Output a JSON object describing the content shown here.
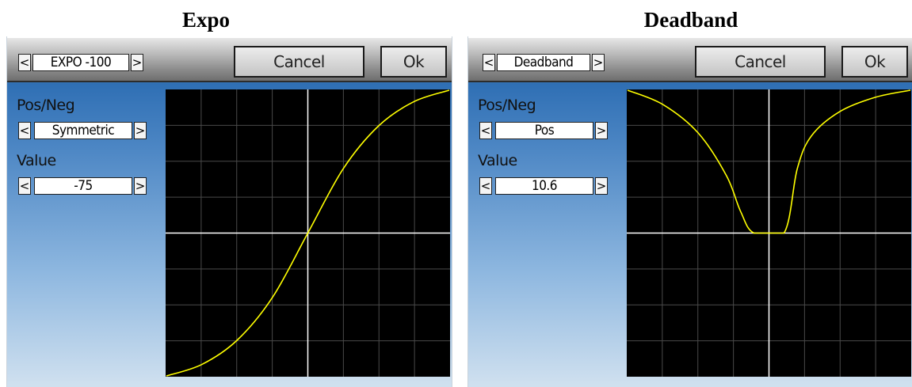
{
  "expo_panel": {
    "title": "Expo",
    "header": {
      "selector": "EXPO -100",
      "prev": "<",
      "next": ">",
      "cancel": "Cancel",
      "ok": "Ok"
    },
    "pos_neg": {
      "label": "Pos/Neg",
      "value": "Symmetric",
      "prev": "<",
      "next": ">"
    },
    "value": {
      "label": "Value",
      "value": "-75",
      "prev": "<",
      "next": ">"
    }
  },
  "deadband_panel": {
    "title": "Deadband",
    "header": {
      "selector": "Deadband",
      "prev": "<",
      "next": ">",
      "cancel": "Cancel",
      "ok": "Ok"
    },
    "pos_neg": {
      "label": "Pos/Neg",
      "value": "Pos",
      "prev": "<",
      "next": ">"
    },
    "value": {
      "label": "Value",
      "value": "10.6",
      "prev": "<",
      "next": ">"
    }
  },
  "colors": {
    "curve": "#ffff00",
    "axis": "#ffffff",
    "grid": "#4a4a4a",
    "plot_bg": "#000000"
  },
  "chart_data": [
    {
      "type": "line",
      "name": "expo-curve",
      "xlim": [
        -1,
        1
      ],
      "ylim": [
        -1,
        1
      ],
      "grid": true,
      "x": [
        -1,
        -0.75,
        -0.5,
        -0.25,
        0,
        0.25,
        0.5,
        0.75,
        1
      ],
      "y": [
        -1,
        -0.92,
        -0.75,
        -0.45,
        0,
        0.45,
        0.75,
        0.92,
        1
      ]
    },
    {
      "type": "line",
      "name": "deadband-curve",
      "xlim": [
        -1,
        1
      ],
      "ylim": [
        -1,
        1
      ],
      "grid": true,
      "x": [
        -1,
        -0.75,
        -0.5,
        -0.3,
        -0.2,
        -0.106,
        0.106,
        0.2,
        0.3,
        0.5,
        0.75,
        1
      ],
      "y": [
        1,
        0.9,
        0.7,
        0.4,
        0.15,
        0,
        0,
        0.45,
        0.68,
        0.85,
        0.95,
        1
      ]
    }
  ]
}
